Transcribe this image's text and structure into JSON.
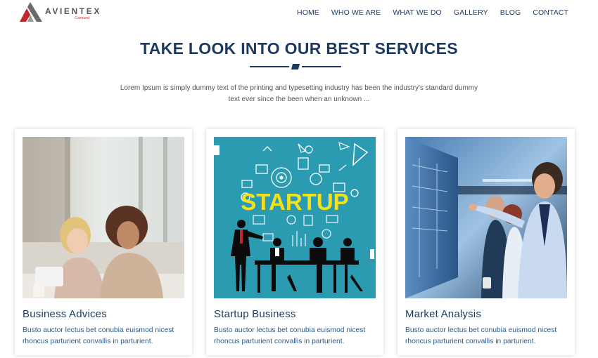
{
  "brand": {
    "name": "AVIENTEX",
    "tagline": "Garment"
  },
  "nav": [
    "HOME",
    "WHO WE ARE",
    "WHAT WE DO",
    "GALLERY",
    "BLOG",
    "CONTACT"
  ],
  "section": {
    "title": "TAKE LOOK INTO OUR BEST SERVICES",
    "intro": "Lorem Ipsum is simply dummy text of the printing and typesetting industry has been the industry's standard dummy text ever since the been when an unknown ..."
  },
  "cards": [
    {
      "title": "Business Advices",
      "text": "Busto auctor lectus bet conubia euismod nicest rhoncus parturient convallis in parturient.",
      "image": "business-meeting-photo"
    },
    {
      "title": "Startup Business",
      "text": "Busto auctor lectus bet conubia euismod nicest rhoncus parturient convallis in parturient.",
      "image": "startup-illustration",
      "image_text": "STARTUP"
    },
    {
      "title": "Market Analysis",
      "text": "Busto auctor lectus bet conubia euismod nicest rhoncus parturient convallis in parturient.",
      "image": "data-screen-team-photo"
    }
  ],
  "colors": {
    "primary": "#1e3a5f",
    "body_link": "#2b5a8a",
    "brand_red": "#c0282d",
    "startup_bg": "#2a9bb0",
    "startup_yellow": "#f2e21e"
  }
}
